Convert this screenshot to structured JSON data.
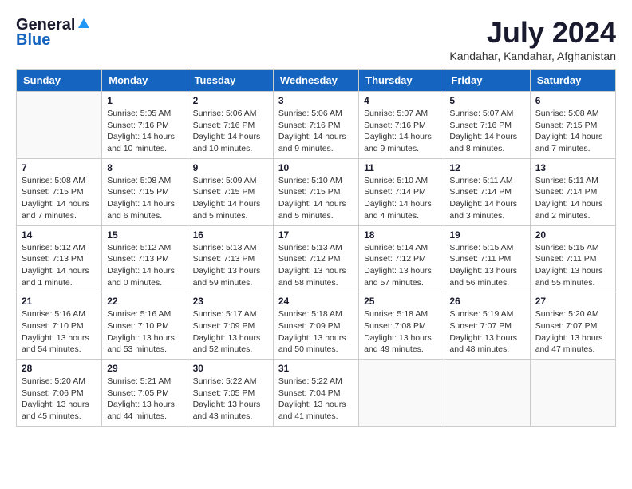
{
  "header": {
    "logo_general": "General",
    "logo_blue": "Blue",
    "month_title": "July 2024",
    "location": "Kandahar, Kandahar, Afghanistan"
  },
  "days_of_week": [
    "Sunday",
    "Monday",
    "Tuesday",
    "Wednesday",
    "Thursday",
    "Friday",
    "Saturday"
  ],
  "weeks": [
    [
      {
        "day": "",
        "info": ""
      },
      {
        "day": "1",
        "info": "Sunrise: 5:05 AM\nSunset: 7:16 PM\nDaylight: 14 hours\nand 10 minutes."
      },
      {
        "day": "2",
        "info": "Sunrise: 5:06 AM\nSunset: 7:16 PM\nDaylight: 14 hours\nand 10 minutes."
      },
      {
        "day": "3",
        "info": "Sunrise: 5:06 AM\nSunset: 7:16 PM\nDaylight: 14 hours\nand 9 minutes."
      },
      {
        "day": "4",
        "info": "Sunrise: 5:07 AM\nSunset: 7:16 PM\nDaylight: 14 hours\nand 9 minutes."
      },
      {
        "day": "5",
        "info": "Sunrise: 5:07 AM\nSunset: 7:16 PM\nDaylight: 14 hours\nand 8 minutes."
      },
      {
        "day": "6",
        "info": "Sunrise: 5:08 AM\nSunset: 7:15 PM\nDaylight: 14 hours\nand 7 minutes."
      }
    ],
    [
      {
        "day": "7",
        "info": "Sunrise: 5:08 AM\nSunset: 7:15 PM\nDaylight: 14 hours\nand 7 minutes."
      },
      {
        "day": "8",
        "info": "Sunrise: 5:08 AM\nSunset: 7:15 PM\nDaylight: 14 hours\nand 6 minutes."
      },
      {
        "day": "9",
        "info": "Sunrise: 5:09 AM\nSunset: 7:15 PM\nDaylight: 14 hours\nand 5 minutes."
      },
      {
        "day": "10",
        "info": "Sunrise: 5:10 AM\nSunset: 7:15 PM\nDaylight: 14 hours\nand 5 minutes."
      },
      {
        "day": "11",
        "info": "Sunrise: 5:10 AM\nSunset: 7:14 PM\nDaylight: 14 hours\nand 4 minutes."
      },
      {
        "day": "12",
        "info": "Sunrise: 5:11 AM\nSunset: 7:14 PM\nDaylight: 14 hours\nand 3 minutes."
      },
      {
        "day": "13",
        "info": "Sunrise: 5:11 AM\nSunset: 7:14 PM\nDaylight: 14 hours\nand 2 minutes."
      }
    ],
    [
      {
        "day": "14",
        "info": "Sunrise: 5:12 AM\nSunset: 7:13 PM\nDaylight: 14 hours\nand 1 minute."
      },
      {
        "day": "15",
        "info": "Sunrise: 5:12 AM\nSunset: 7:13 PM\nDaylight: 14 hours\nand 0 minutes."
      },
      {
        "day": "16",
        "info": "Sunrise: 5:13 AM\nSunset: 7:13 PM\nDaylight: 13 hours\nand 59 minutes."
      },
      {
        "day": "17",
        "info": "Sunrise: 5:13 AM\nSunset: 7:12 PM\nDaylight: 13 hours\nand 58 minutes."
      },
      {
        "day": "18",
        "info": "Sunrise: 5:14 AM\nSunset: 7:12 PM\nDaylight: 13 hours\nand 57 minutes."
      },
      {
        "day": "19",
        "info": "Sunrise: 5:15 AM\nSunset: 7:11 PM\nDaylight: 13 hours\nand 56 minutes."
      },
      {
        "day": "20",
        "info": "Sunrise: 5:15 AM\nSunset: 7:11 PM\nDaylight: 13 hours\nand 55 minutes."
      }
    ],
    [
      {
        "day": "21",
        "info": "Sunrise: 5:16 AM\nSunset: 7:10 PM\nDaylight: 13 hours\nand 54 minutes."
      },
      {
        "day": "22",
        "info": "Sunrise: 5:16 AM\nSunset: 7:10 PM\nDaylight: 13 hours\nand 53 minutes."
      },
      {
        "day": "23",
        "info": "Sunrise: 5:17 AM\nSunset: 7:09 PM\nDaylight: 13 hours\nand 52 minutes."
      },
      {
        "day": "24",
        "info": "Sunrise: 5:18 AM\nSunset: 7:09 PM\nDaylight: 13 hours\nand 50 minutes."
      },
      {
        "day": "25",
        "info": "Sunrise: 5:18 AM\nSunset: 7:08 PM\nDaylight: 13 hours\nand 49 minutes."
      },
      {
        "day": "26",
        "info": "Sunrise: 5:19 AM\nSunset: 7:07 PM\nDaylight: 13 hours\nand 48 minutes."
      },
      {
        "day": "27",
        "info": "Sunrise: 5:20 AM\nSunset: 7:07 PM\nDaylight: 13 hours\nand 47 minutes."
      }
    ],
    [
      {
        "day": "28",
        "info": "Sunrise: 5:20 AM\nSunset: 7:06 PM\nDaylight: 13 hours\nand 45 minutes."
      },
      {
        "day": "29",
        "info": "Sunrise: 5:21 AM\nSunset: 7:05 PM\nDaylight: 13 hours\nand 44 minutes."
      },
      {
        "day": "30",
        "info": "Sunrise: 5:22 AM\nSunset: 7:05 PM\nDaylight: 13 hours\nand 43 minutes."
      },
      {
        "day": "31",
        "info": "Sunrise: 5:22 AM\nSunset: 7:04 PM\nDaylight: 13 hours\nand 41 minutes."
      },
      {
        "day": "",
        "info": ""
      },
      {
        "day": "",
        "info": ""
      },
      {
        "day": "",
        "info": ""
      }
    ]
  ]
}
